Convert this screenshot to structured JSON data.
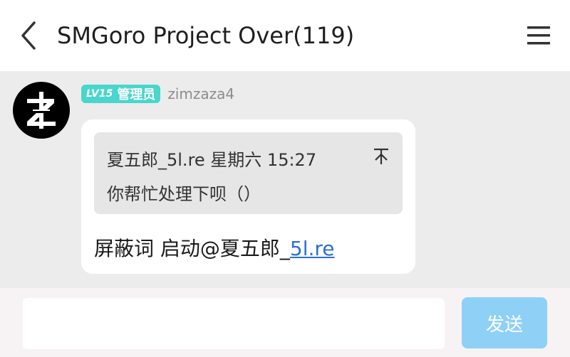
{
  "header": {
    "title": "SMGoro Project Over(119)",
    "back_icon": "chevron-left-icon",
    "menu_icon": "hamburger-menu-icon"
  },
  "message": {
    "avatar_icon": "zimzaza-logo-icon",
    "level_badge": "LV15",
    "role_badge": "管理员",
    "badge_color": "#49d6cc",
    "username": "zimzaza4",
    "quote": {
      "header": "夏五郎_5l.re 星期六 15:27",
      "body": "你帮忙处理下呗（）",
      "icon": "jump-to-top-icon"
    },
    "text_prefix": "屏蔽词 启动@夏五郎_",
    "link_text": "5l.re",
    "link_color": "#2b6fd6"
  },
  "input_bar": {
    "placeholder": "",
    "send_label": "发送",
    "send_color": "#8fd0f7"
  }
}
